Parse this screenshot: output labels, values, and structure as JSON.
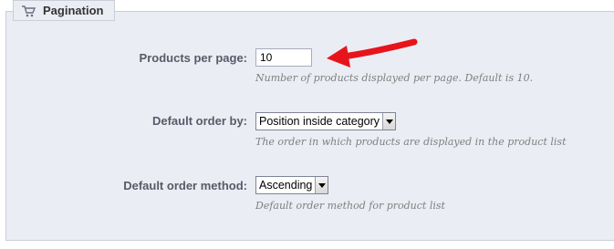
{
  "section": {
    "title": "Pagination",
    "icon": "cart-icon"
  },
  "fields": {
    "products_per_page": {
      "label": "Products per page:",
      "value": "10",
      "hint": "Number of products displayed per page. Default is 10."
    },
    "default_order_by": {
      "label": "Default order by:",
      "selected": "Position inside category",
      "hint": "The order in which products are displayed in the product list"
    },
    "default_order_method": {
      "label": "Default order method:",
      "selected": "Ascending",
      "hint": "Default order method for product list"
    }
  },
  "annotation": {
    "type": "arrow-icon",
    "color": "#e8141b"
  }
}
